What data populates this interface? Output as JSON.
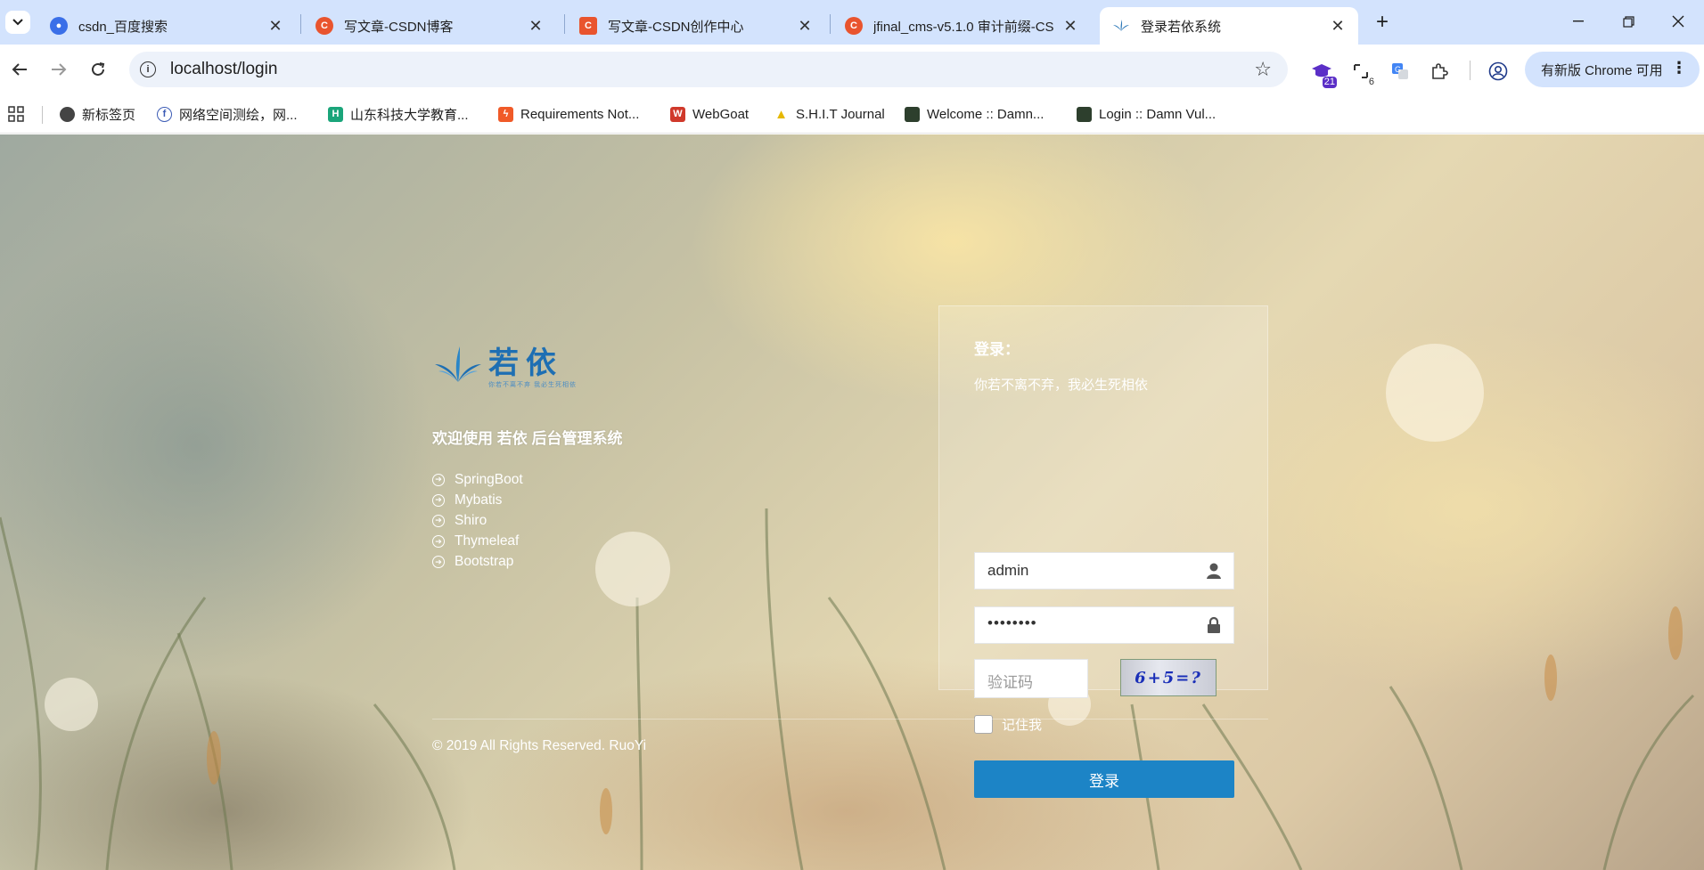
{
  "browser": {
    "tabs": [
      {
        "title": "csdn_百度搜索",
        "favicon": "baidu-paw-icon",
        "color": "#3a6fe8"
      },
      {
        "title": "写文章-CSDN博客",
        "favicon": "csdn-c-icon",
        "color": "#e9542e"
      },
      {
        "title": "写文章-CSDN创作中心",
        "favicon": "csdn-square-icon",
        "color": "#e9542e"
      },
      {
        "title": "jfinal_cms-v5.1.0 审计前缀-CS",
        "favicon": "csdn-c-icon",
        "color": "#e9542e"
      },
      {
        "title": "登录若依系统",
        "favicon": "ruoyi-leaf-icon",
        "color": "#1e6fb3"
      }
    ],
    "url": "localhost/login",
    "update_label": "有新版 Chrome 可用",
    "ext_badges": {
      "first": "21",
      "second": "6"
    },
    "bookmarks": [
      {
        "label": "新标签页",
        "icon": "globe-icon",
        "color": "#444444"
      },
      {
        "label": "网络空间测绘，网...",
        "icon": "fofa-icon",
        "color": "#3b5bb5"
      },
      {
        "label": "山东科技大学教育...",
        "icon": "h-icon",
        "color": "#1aa57a"
      },
      {
        "label": "Requirements Not...",
        "icon": "bolt-icon",
        "color": "#f05a28"
      },
      {
        "label": "WebGoat",
        "icon": "goat-icon",
        "color": "#d0392b"
      },
      {
        "label": "S.H.I.T Journal",
        "icon": "bell-icon",
        "color": "#e6b800"
      },
      {
        "label": "Welcome :: Damn...",
        "icon": "dvwa-icon",
        "color": "#2d3f2d"
      },
      {
        "label": "Login :: Damn Vul...",
        "icon": "dvwa-icon",
        "color": "#2d3f2d"
      }
    ]
  },
  "page": {
    "brand": {
      "title": "若依",
      "subtitle": "你若不离不弃 我必生死相依"
    },
    "welcome": "欢迎使用 若依 后台管理系统",
    "tech": [
      "SpringBoot",
      "Mybatis",
      "Shiro",
      "Thymeleaf",
      "Bootstrap"
    ],
    "login": {
      "title": "登录：",
      "motto": "你若不离不弃，我必生死相依",
      "username": "admin",
      "password_mask": "••••••••",
      "captcha_placeholder": "验证码",
      "captcha_text": "6+5=?",
      "remember": "记住我",
      "submit": "登录",
      "accent": "#1c84c6"
    },
    "copyright": "© 2019 All Rights Reserved. RuoYi"
  }
}
